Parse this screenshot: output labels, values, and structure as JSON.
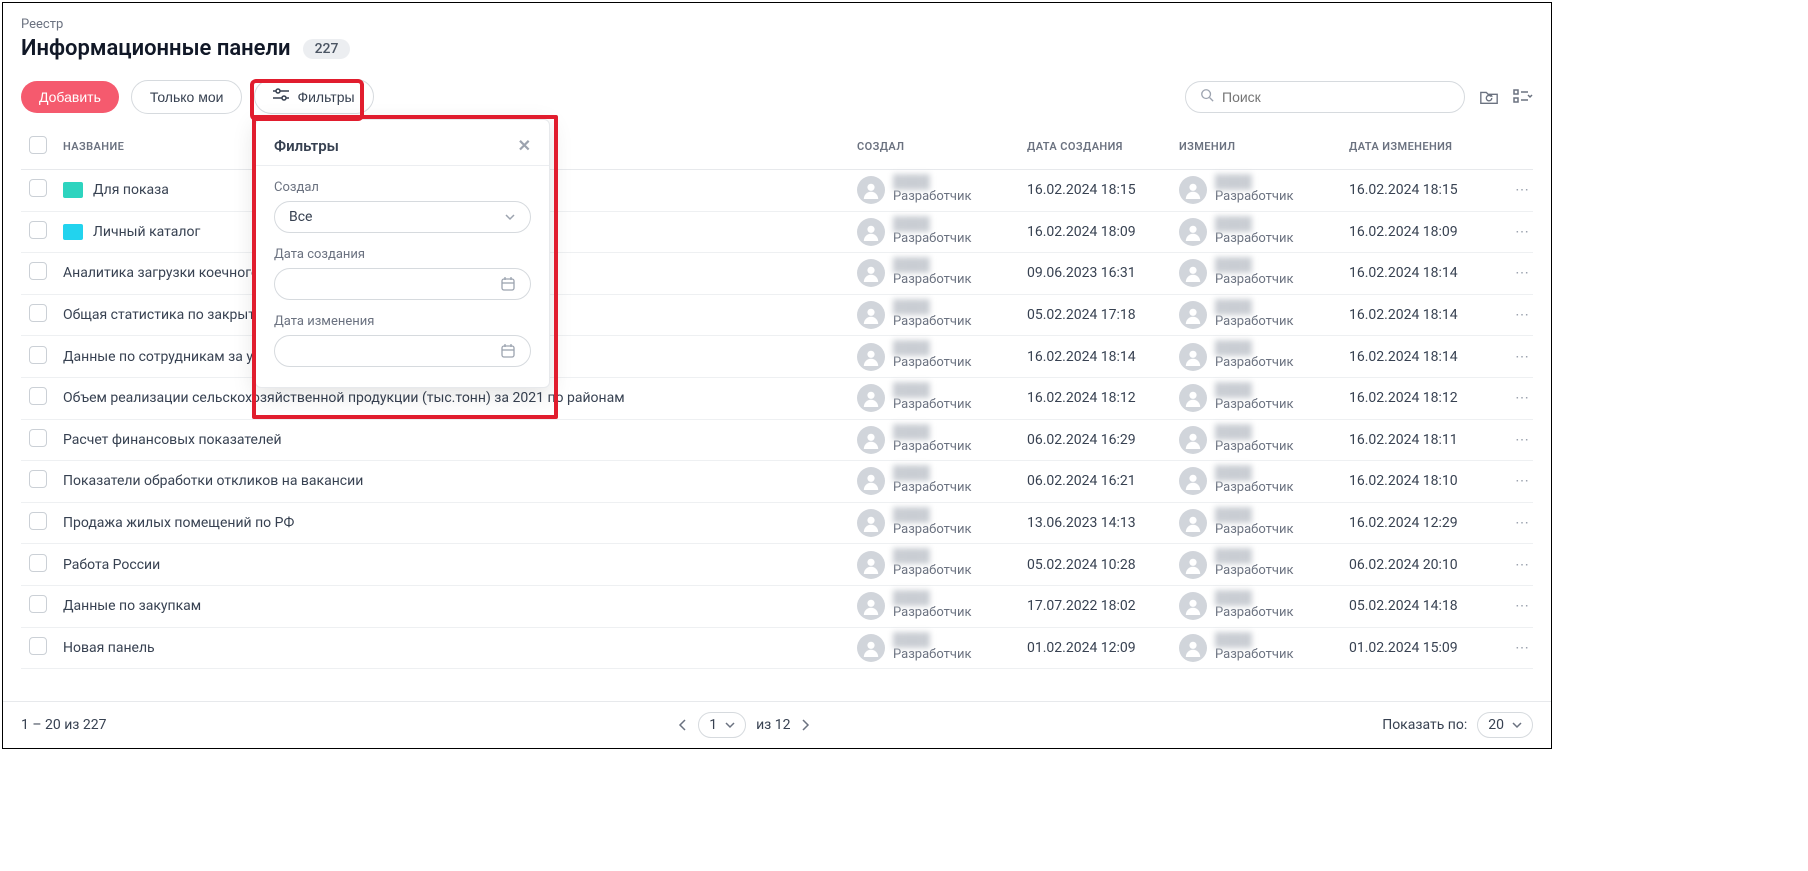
{
  "breadcrumb": "Реестр",
  "title": "Информационные панели",
  "count": "227",
  "toolbar": {
    "add": "Добавить",
    "mine": "Только мои",
    "filters": "Фильтры",
    "search_placeholder": "Поиск"
  },
  "columns": {
    "name": "НАЗВАНИЕ",
    "created_by": "СОЗДАЛ",
    "created_at": "ДАТА СОЗДАНИЯ",
    "changed_by": "ИЗМЕНИЛ",
    "changed_at": "ДАТА ИЗМЕНЕНИЯ"
  },
  "role_label": "Разработчик",
  "rows": [
    {
      "icon": "folder-teal",
      "name": "Для показа",
      "created_at": "16.02.2024 18:15",
      "changed_at": "16.02.2024 18:15"
    },
    {
      "icon": "folder-cyan",
      "name": "Личный каталог",
      "created_at": "16.02.2024 18:09",
      "changed_at": "16.02.2024 18:09"
    },
    {
      "icon": "",
      "name": "Аналитика загрузки коечного фонда",
      "created_at": "09.06.2023 16:31",
      "changed_at": "16.02.2024 18:14"
    },
    {
      "icon": "",
      "name": "Общая статистика по закрытым вакансиям",
      "created_at": "05.02.2024 17:18",
      "changed_at": "16.02.2024 18:14"
    },
    {
      "icon": "",
      "name": "Данные по сотрудникам за указанный период",
      "created_at": "16.02.2024 18:14",
      "changed_at": "16.02.2024 18:14"
    },
    {
      "icon": "",
      "name": "Объем реализации сельскохозяйственной продукции (тыс.тонн) за 2021 по районам",
      "created_at": "16.02.2024 18:12",
      "changed_at": "16.02.2024 18:12"
    },
    {
      "icon": "",
      "name": "Расчет финансовых показателей",
      "created_at": "06.02.2024 16:29",
      "changed_at": "16.02.2024 18:11"
    },
    {
      "icon": "",
      "name": "Показатели обработки откликов на вакансии",
      "created_at": "06.02.2024 16:21",
      "changed_at": "16.02.2024 18:10"
    },
    {
      "icon": "",
      "name": "Продажа жилых помещений по РФ",
      "created_at": "13.06.2023 14:13",
      "changed_at": "16.02.2024 12:29"
    },
    {
      "icon": "",
      "name": "Работа России",
      "created_at": "05.02.2024 10:28",
      "changed_at": "06.02.2024 20:10"
    },
    {
      "icon": "",
      "name": "Данные по закупкам",
      "created_at": "17.07.2022 18:02",
      "changed_at": "05.02.2024 14:18"
    },
    {
      "icon": "",
      "name": "Новая панель",
      "created_at": "01.02.2024 12:09",
      "changed_at": "01.02.2024 15:09"
    }
  ],
  "footer": {
    "range": "1 – 20 из 227",
    "page": "1",
    "of_pages": "из 12",
    "show_label": "Показать по:",
    "page_size": "20"
  },
  "popover": {
    "title": "Фильтры",
    "created_by_label": "Создал",
    "created_by_value": "Все",
    "created_at_label": "Дата создания",
    "changed_at_label": "Дата изменения"
  }
}
